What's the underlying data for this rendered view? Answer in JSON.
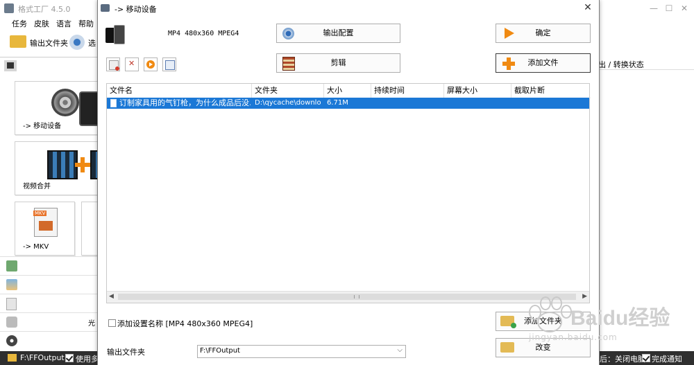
{
  "app": {
    "title": "格式工厂 4.5.0",
    "menu": [
      "任务",
      "皮肤",
      "语言",
      "帮助"
    ],
    "toolbar": {
      "output_folder": "输出文件夹",
      "options": "选"
    }
  },
  "left_panel": {
    "cards": [
      {
        "label": "-> 移动设备"
      },
      {
        "label": "视频合并"
      },
      {
        "label": "-> MKV"
      }
    ],
    "side_extra": "光"
  },
  "right_panel": {
    "header": "出 / 转换状态"
  },
  "statusbar": {
    "path": "F:\\FFOutput",
    "use_multi": "使用多",
    "after": "后：关闭电脑",
    "notify": "完成通知"
  },
  "dialog": {
    "title": "-> 移动设备",
    "format": "MP4 480x360 MPEG4",
    "buttons": {
      "output_config": "输出配置",
      "ok": "确定",
      "clip": "剪辑",
      "add_file": "添加文件",
      "add_folder": "添加文件夹",
      "change": "改变"
    },
    "table": {
      "columns": [
        "文件名",
        "文件夹",
        "大小",
        "持续时间",
        "屏幕大小",
        "截取片断"
      ],
      "rows": [
        {
          "name": "订制家具用的气钉枪，为什么成品后没…",
          "folder": "D:\\qycache\\downlo…",
          "size": "6.71M",
          "duration": "",
          "screen": "",
          "clip": ""
        }
      ]
    },
    "add_setting_label": "添加设置名称 [MP4 480x360 MPEG4]",
    "output_folder_label": "输出文件夹",
    "output_folder_value": "F:\\FFOutput"
  },
  "watermark": {
    "text": "Baidu经验",
    "url": "jingyan.baidu.com"
  }
}
